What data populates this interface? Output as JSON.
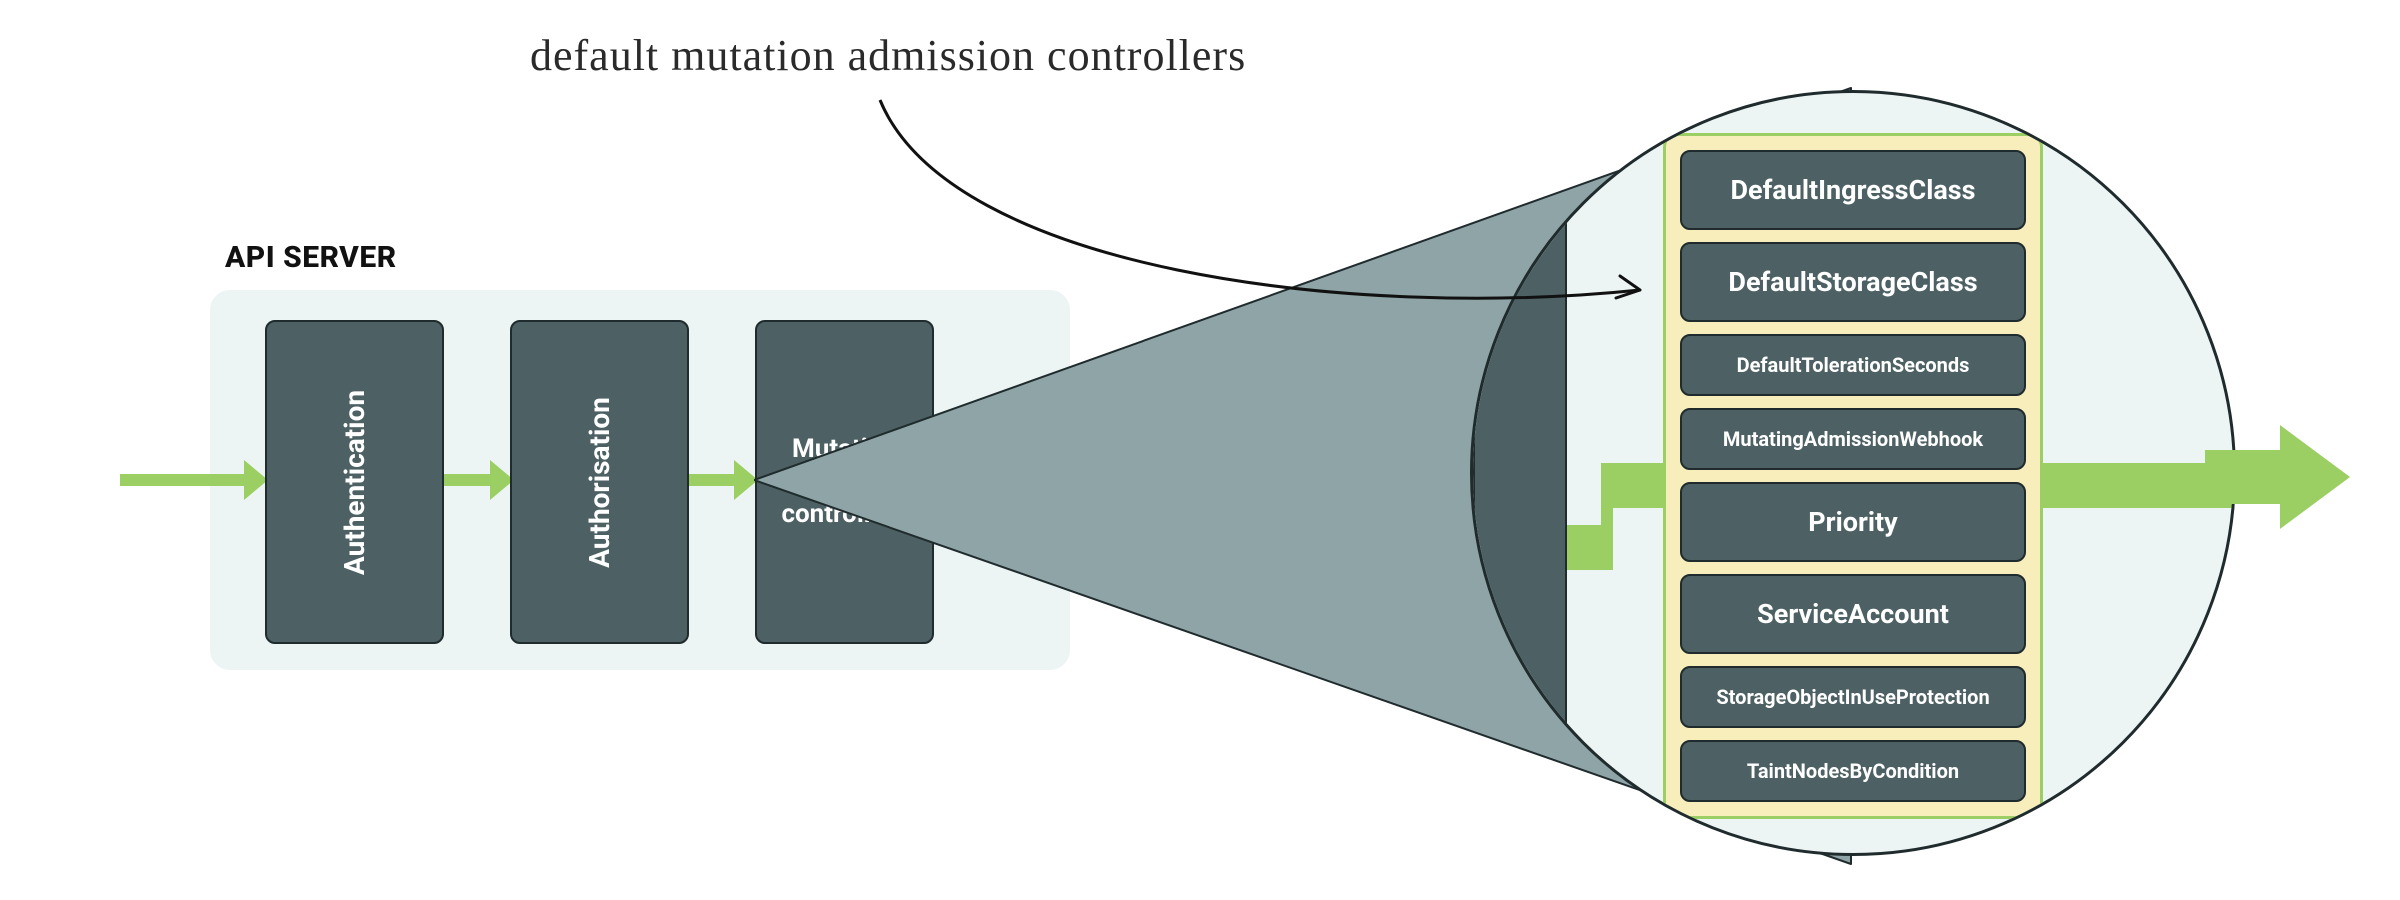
{
  "header": {
    "server_label": "API SERVER"
  },
  "stages": {
    "auth_label": "Authentication",
    "authz_label": "Authorisation",
    "mutation_label": "Mutation admission controllers"
  },
  "annotation": {
    "text": "default mutation admission controllers"
  },
  "controllers": [
    {
      "label": "DefaultIngressClass",
      "size": "big"
    },
    {
      "label": "DefaultStorageClass",
      "size": "big"
    },
    {
      "label": "DefaultTolerationSeconds",
      "size": "small"
    },
    {
      "label": "MutatingAdmissionWebhook",
      "size": "small"
    },
    {
      "label": "Priority",
      "size": "big"
    },
    {
      "label": "ServiceAccount",
      "size": "big"
    },
    {
      "label": "StorageObjectInUseProtection",
      "size": "small"
    },
    {
      "label": "TaintNodesByCondition",
      "size": "small"
    }
  ],
  "colors": {
    "box": "#4d6164",
    "panel": "#edf4f4",
    "accent": "#9ccf63",
    "highlight_panel": "#f7eebc",
    "stroke": "#1f2b2d"
  }
}
